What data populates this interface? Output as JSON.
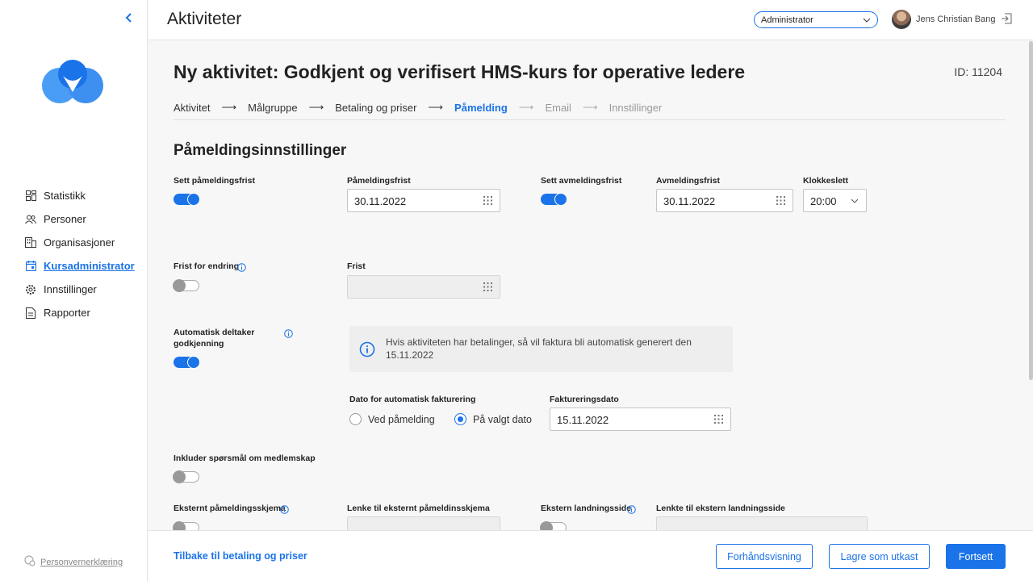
{
  "sidebar": {
    "collapse_icon": "chevron-left-icon",
    "items": [
      {
        "label": "Statistikk",
        "icon": "dashboard-icon"
      },
      {
        "label": "Personer",
        "icon": "people-icon"
      },
      {
        "label": "Organisasjoner",
        "icon": "building-icon"
      },
      {
        "label": "Kursadministrator",
        "icon": "calendar-icon",
        "active": true
      },
      {
        "label": "Innstillinger",
        "icon": "gear-icon"
      },
      {
        "label": "Rapporter",
        "icon": "report-icon"
      }
    ],
    "privacy_label": "Personvernerklæring"
  },
  "header": {
    "title": "Aktiviteter",
    "role": "Administrator",
    "user_name": "Jens Christian Bang"
  },
  "page": {
    "title": "Ny aktivitet: Godkjent og verifisert HMS-kurs for operative ledere",
    "id_label": "ID: 11204",
    "steps": [
      {
        "label": "Aktivitet",
        "state": "done"
      },
      {
        "label": "Målgruppe",
        "state": "done"
      },
      {
        "label": "Betaling og priser",
        "state": "done"
      },
      {
        "label": "Påmelding",
        "state": "active"
      },
      {
        "label": "Email",
        "state": "disabled"
      },
      {
        "label": "Innstillinger",
        "state": "disabled"
      }
    ],
    "section_title": "Påmeldingsinnstillinger"
  },
  "form": {
    "set_deadline_label": "Sett påmeldingsfrist",
    "deadline_label": "Påmeldingsfrist",
    "deadline_value": "30.11.2022",
    "set_cancel_label": "Sett avmeldingsfrist",
    "cancel_deadline_label": "Avmeldingsfrist",
    "cancel_deadline_value": "30.11.2022",
    "time_label": "Klokkeslett",
    "time_value": "20:00",
    "change_deadline_label": "Frist for endring",
    "frist_label": "Frist",
    "frist_value": "",
    "auto_approval_label": "Automatisk deltaker godkjenning",
    "info_text": "Hvis aktiviteten har betalinger, så vil faktura bli automatisk generert den 15.11.2022",
    "auto_invoice_date_label": "Dato for automatisk fakturering",
    "radio_on_signup": "Ved påmelding",
    "radio_chosen_date": "På valgt dato",
    "invoice_date_label": "Faktureringsdato",
    "invoice_date_value": "15.11.2022",
    "membership_label": "Inkluder spørsmål om medlemskap",
    "external_form_label": "Eksternt påmeldingsskjema",
    "external_form_link_label": "Lenke til eksternt påmeldinsskjema",
    "external_landing_label": "Ekstern landningsside",
    "external_landing_link_label": "Lenkte til ekstern landningsside"
  },
  "footer": {
    "back_label": "Tilbake til betaling og priser",
    "preview_label": "Forhåndsvisning",
    "draft_label": "Lagre som utkast",
    "continue_label": "Fortsett"
  },
  "colors": {
    "accent": "#1a73e8"
  }
}
